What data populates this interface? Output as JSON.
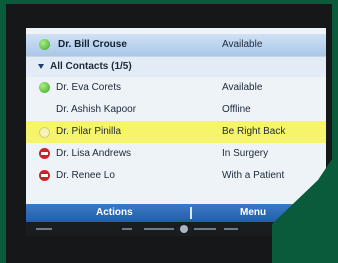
{
  "contacts": {
    "pinned": {
      "name": "Dr. Bill Crouse",
      "status": "Available",
      "presence_icon": "available-dot-icon"
    },
    "group": {
      "label": "All Contacts (1/5)",
      "caret_icon": "caret-down-icon"
    },
    "rows": [
      {
        "name": "Dr. Eva Corets",
        "status": "Available",
        "presence": "green",
        "icon": "available-dot-icon"
      },
      {
        "name": "Dr. Ashish Kapoor",
        "status": "Offline",
        "presence": "none",
        "icon": ""
      },
      {
        "name": "Dr. Pilar Pinilla",
        "status": "Be Right Back",
        "presence": "yellow",
        "icon": "away-dot-icon",
        "highlighted": true
      },
      {
        "name": "Dr. Lisa Andrews",
        "status": "In Surgery",
        "presence": "red",
        "icon": "busy-dot-icon"
      },
      {
        "name": "Dr. Renee Lo",
        "status": "With a Patient",
        "presence": "red",
        "icon": "busy-dot-icon"
      }
    ]
  },
  "softkeys": {
    "left": "Actions",
    "right": "Menu"
  },
  "colors": {
    "available": "#3aa52a",
    "busy": "#c8242a",
    "away": "#f7f2b5",
    "highlight": "#f6f46a",
    "softbar": "#2d6bb8",
    "green_corner": "#0a5a3c"
  }
}
